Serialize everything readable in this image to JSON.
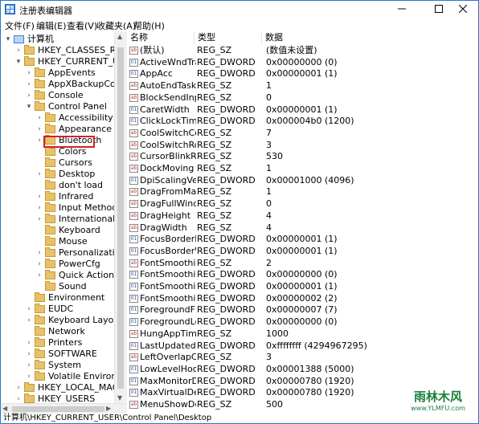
{
  "window": {
    "title": "注册表编辑器",
    "icons": {
      "app": "regedit-icon",
      "minimize": "minimize-icon",
      "maximize": "maximize-icon",
      "close": "close-icon"
    }
  },
  "menu": [
    "文件(F)",
    "编辑(E)",
    "查看(V)",
    "收藏夹(A)",
    "帮助(H)"
  ],
  "tree": [
    {
      "label": "计算机",
      "level": 0,
      "expanded": true,
      "icon": "computer-icon"
    },
    {
      "label": "HKEY_CLASSES_ROOT",
      "level": 1,
      "expanded": false,
      "icon": "folder-icon"
    },
    {
      "label": "HKEY_CURRENT_USER",
      "level": 1,
      "expanded": true,
      "icon": "folder-icon"
    },
    {
      "label": "AppEvents",
      "level": 2,
      "expanded": false,
      "icon": "folder-icon"
    },
    {
      "label": "AppXBackupContentType",
      "level": 2,
      "expanded": false,
      "icon": "folder-icon"
    },
    {
      "label": "Console",
      "level": 2,
      "expanded": false,
      "icon": "folder-icon"
    },
    {
      "label": "Control Panel",
      "level": 2,
      "expanded": true,
      "icon": "folder-icon"
    },
    {
      "label": "Accessibility",
      "level": 3,
      "expanded": false,
      "icon": "folder-icon"
    },
    {
      "label": "Appearance",
      "level": 3,
      "expanded": false,
      "icon": "folder-icon"
    },
    {
      "label": "Bluetooth",
      "level": 3,
      "expanded": false,
      "icon": "folder-icon"
    },
    {
      "label": "Colors",
      "level": 3,
      "leaf": true,
      "icon": "folder-icon"
    },
    {
      "label": "Cursors",
      "level": 3,
      "leaf": true,
      "icon": "folder-icon"
    },
    {
      "label": "Desktop",
      "level": 3,
      "expanded": false,
      "selected": true,
      "icon": "folder-icon"
    },
    {
      "label": "don't load",
      "level": 3,
      "leaf": true,
      "icon": "folder-icon"
    },
    {
      "label": "Infrared",
      "level": 3,
      "expanded": false,
      "icon": "folder-icon"
    },
    {
      "label": "Input Method",
      "level": 3,
      "expanded": false,
      "icon": "folder-icon"
    },
    {
      "label": "International",
      "level": 3,
      "expanded": false,
      "icon": "folder-icon"
    },
    {
      "label": "Keyboard",
      "level": 3,
      "leaf": true,
      "icon": "folder-icon"
    },
    {
      "label": "Mouse",
      "level": 3,
      "leaf": true,
      "icon": "folder-icon"
    },
    {
      "label": "Personalization",
      "level": 3,
      "expanded": false,
      "icon": "folder-icon"
    },
    {
      "label": "PowerCfg",
      "level": 3,
      "expanded": false,
      "icon": "folder-icon"
    },
    {
      "label": "Quick Actions",
      "level": 3,
      "expanded": false,
      "icon": "folder-icon"
    },
    {
      "label": "Sound",
      "level": 3,
      "leaf": true,
      "icon": "folder-icon"
    },
    {
      "label": "Environment",
      "level": 2,
      "leaf": true,
      "icon": "folder-icon"
    },
    {
      "label": "EUDC",
      "level": 2,
      "expanded": false,
      "icon": "folder-icon"
    },
    {
      "label": "Keyboard Layout",
      "level": 2,
      "expanded": false,
      "icon": "folder-icon"
    },
    {
      "label": "Network",
      "level": 2,
      "leaf": true,
      "icon": "folder-icon"
    },
    {
      "label": "Printers",
      "level": 2,
      "expanded": false,
      "icon": "folder-icon"
    },
    {
      "label": "SOFTWARE",
      "level": 2,
      "expanded": false,
      "icon": "folder-icon"
    },
    {
      "label": "System",
      "level": 2,
      "expanded": false,
      "icon": "folder-icon"
    },
    {
      "label": "Volatile Environment",
      "level": 2,
      "expanded": false,
      "icon": "folder-icon"
    },
    {
      "label": "HKEY_LOCAL_MACHINE",
      "level": 1,
      "expanded": false,
      "icon": "folder-icon"
    },
    {
      "label": "HKEY_USERS",
      "level": 1,
      "expanded": false,
      "icon": "folder-icon"
    }
  ],
  "columns": [
    "名称",
    "类型",
    "数据"
  ],
  "values": [
    {
      "name": "(默认)",
      "type": "REG_SZ",
      "data": "(数值未设置)",
      "icon": "string-value-icon"
    },
    {
      "name": "ActiveWndTrackTimeout",
      "type": "REG_DWORD",
      "data": "0x00000000 (0)",
      "icon": "binary-value-icon"
    },
    {
      "name": "AppAcc",
      "type": "REG_DWORD",
      "data": "0x00000001 (1)",
      "icon": "binary-value-icon"
    },
    {
      "name": "AutoEndTasks",
      "type": "REG_SZ",
      "data": "1",
      "icon": "string-value-icon"
    },
    {
      "name": "BlockSendInputResets",
      "type": "REG_SZ",
      "data": "0",
      "icon": "string-value-icon"
    },
    {
      "name": "CaretWidth",
      "type": "REG_DWORD",
      "data": "0x00000001 (1)",
      "icon": "binary-value-icon"
    },
    {
      "name": "ClickLockTime",
      "type": "REG_DWORD",
      "data": "0x000004b0 (1200)",
      "icon": "binary-value-icon"
    },
    {
      "name": "CoolSwitchColumns",
      "type": "REG_SZ",
      "data": "7",
      "icon": "string-value-icon"
    },
    {
      "name": "CoolSwitchRows",
      "type": "REG_SZ",
      "data": "3",
      "icon": "string-value-icon"
    },
    {
      "name": "CursorBlinkRate",
      "type": "REG_SZ",
      "data": "530",
      "icon": "string-value-icon"
    },
    {
      "name": "DockMoving",
      "type": "REG_SZ",
      "data": "1",
      "icon": "string-value-icon"
    },
    {
      "name": "DpiScalingVer",
      "type": "REG_DWORD",
      "data": "0x00001000 (4096)",
      "icon": "binary-value-icon"
    },
    {
      "name": "DragFromMaximize",
      "type": "REG_SZ",
      "data": "1",
      "icon": "string-value-icon"
    },
    {
      "name": "DragFullWindows",
      "type": "REG_SZ",
      "data": "0",
      "icon": "string-value-icon"
    },
    {
      "name": "DragHeight",
      "type": "REG_SZ",
      "data": "4",
      "icon": "string-value-icon"
    },
    {
      "name": "DragWidth",
      "type": "REG_SZ",
      "data": "4",
      "icon": "string-value-icon"
    },
    {
      "name": "FocusBorderHeight",
      "type": "REG_DWORD",
      "data": "0x00000001 (1)",
      "icon": "binary-value-icon"
    },
    {
      "name": "FocusBorderWidth",
      "type": "REG_DWORD",
      "data": "0x00000001 (1)",
      "icon": "binary-value-icon"
    },
    {
      "name": "FontSmoothing",
      "type": "REG_SZ",
      "data": "2",
      "icon": "string-value-icon"
    },
    {
      "name": "FontSmoothingGamma",
      "type": "REG_DWORD",
      "data": "0x00000000 (0)",
      "icon": "binary-value-icon"
    },
    {
      "name": "FontSmoothingOrientation",
      "type": "REG_DWORD",
      "data": "0x00000001 (1)",
      "icon": "binary-value-icon"
    },
    {
      "name": "FontSmoothingType",
      "type": "REG_DWORD",
      "data": "0x00000002 (2)",
      "icon": "binary-value-icon"
    },
    {
      "name": "ForegroundFlashCount",
      "type": "REG_DWORD",
      "data": "0x00000007 (7)",
      "icon": "binary-value-icon"
    },
    {
      "name": "ForegroundLockTimeout",
      "type": "REG_DWORD",
      "data": "0x00000000 (0)",
      "icon": "binary-value-icon"
    },
    {
      "name": "HungAppTimeout",
      "type": "REG_SZ",
      "data": "1000",
      "icon": "string-value-icon"
    },
    {
      "name": "LastUpdated",
      "type": "REG_DWORD",
      "data": "0xffffffff (4294967295)",
      "icon": "binary-value-icon"
    },
    {
      "name": "LeftOverlapChars",
      "type": "REG_SZ",
      "data": "3",
      "icon": "string-value-icon"
    },
    {
      "name": "LowLevelHooksTimeout",
      "type": "REG_DWORD",
      "data": "0x00001388 (5000)",
      "icon": "binary-value-icon"
    },
    {
      "name": "MaxMonitorDimension",
      "type": "REG_DWORD",
      "data": "0x00000780 (1920)",
      "icon": "binary-value-icon"
    },
    {
      "name": "MaxVirtualDesktopDimension",
      "type": "REG_DWORD",
      "data": "0x00000780 (1920)",
      "icon": "binary-value-icon"
    },
    {
      "name": "MenuShowDelay",
      "type": "REG_SZ",
      "data": "500",
      "icon": "string-value-icon"
    }
  ],
  "status": "计算机\\HKEY_CURRENT_USER\\Control Panel\\Desktop",
  "watermark": {
    "main": "雨林木风",
    "url": "www.YLMFU.com"
  }
}
